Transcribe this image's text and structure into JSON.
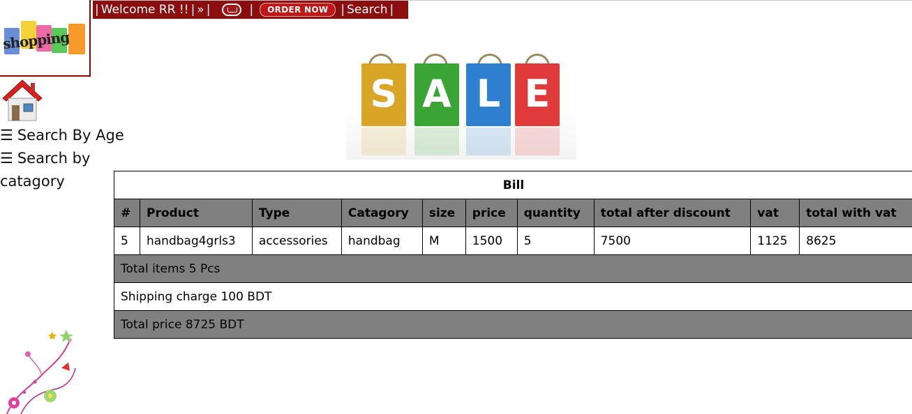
{
  "header": {
    "logo_text": "shopping",
    "welcome": "Welcome RR !!",
    "arrow": "»",
    "order_now": "ORDER NOW",
    "search": "Search",
    "icons": [
      "shopping-logo",
      "cart-icon"
    ]
  },
  "nav": {
    "home_icon": "home-icon",
    "search_by_age": "Search By Age",
    "search_by_category": "Search by catagory"
  },
  "banner": {
    "letters": [
      "S",
      "A",
      "L",
      "E"
    ],
    "bag_colors": [
      "#d9a526",
      "#3aa535",
      "#2f7fd0",
      "#e03a3a"
    ]
  },
  "bill": {
    "title": "Bill",
    "columns": [
      "#",
      "Product",
      "Type",
      "Catagory",
      "size",
      "price",
      "quantity",
      "total after discount",
      "vat",
      "total with vat"
    ],
    "rows": [
      [
        "5",
        "handbag4grls3",
        "accessories",
        "handbag",
        "M",
        "1500",
        "5",
        "7500",
        "1125",
        "8625"
      ]
    ],
    "total_items": "Total items 5 Pcs",
    "shipping": "Shipping charge 100 BDT",
    "total_price": "Total price 8725 BDT"
  },
  "colors": {
    "topbar_bg": "#8b0d0d",
    "table_grey": "#808080"
  }
}
